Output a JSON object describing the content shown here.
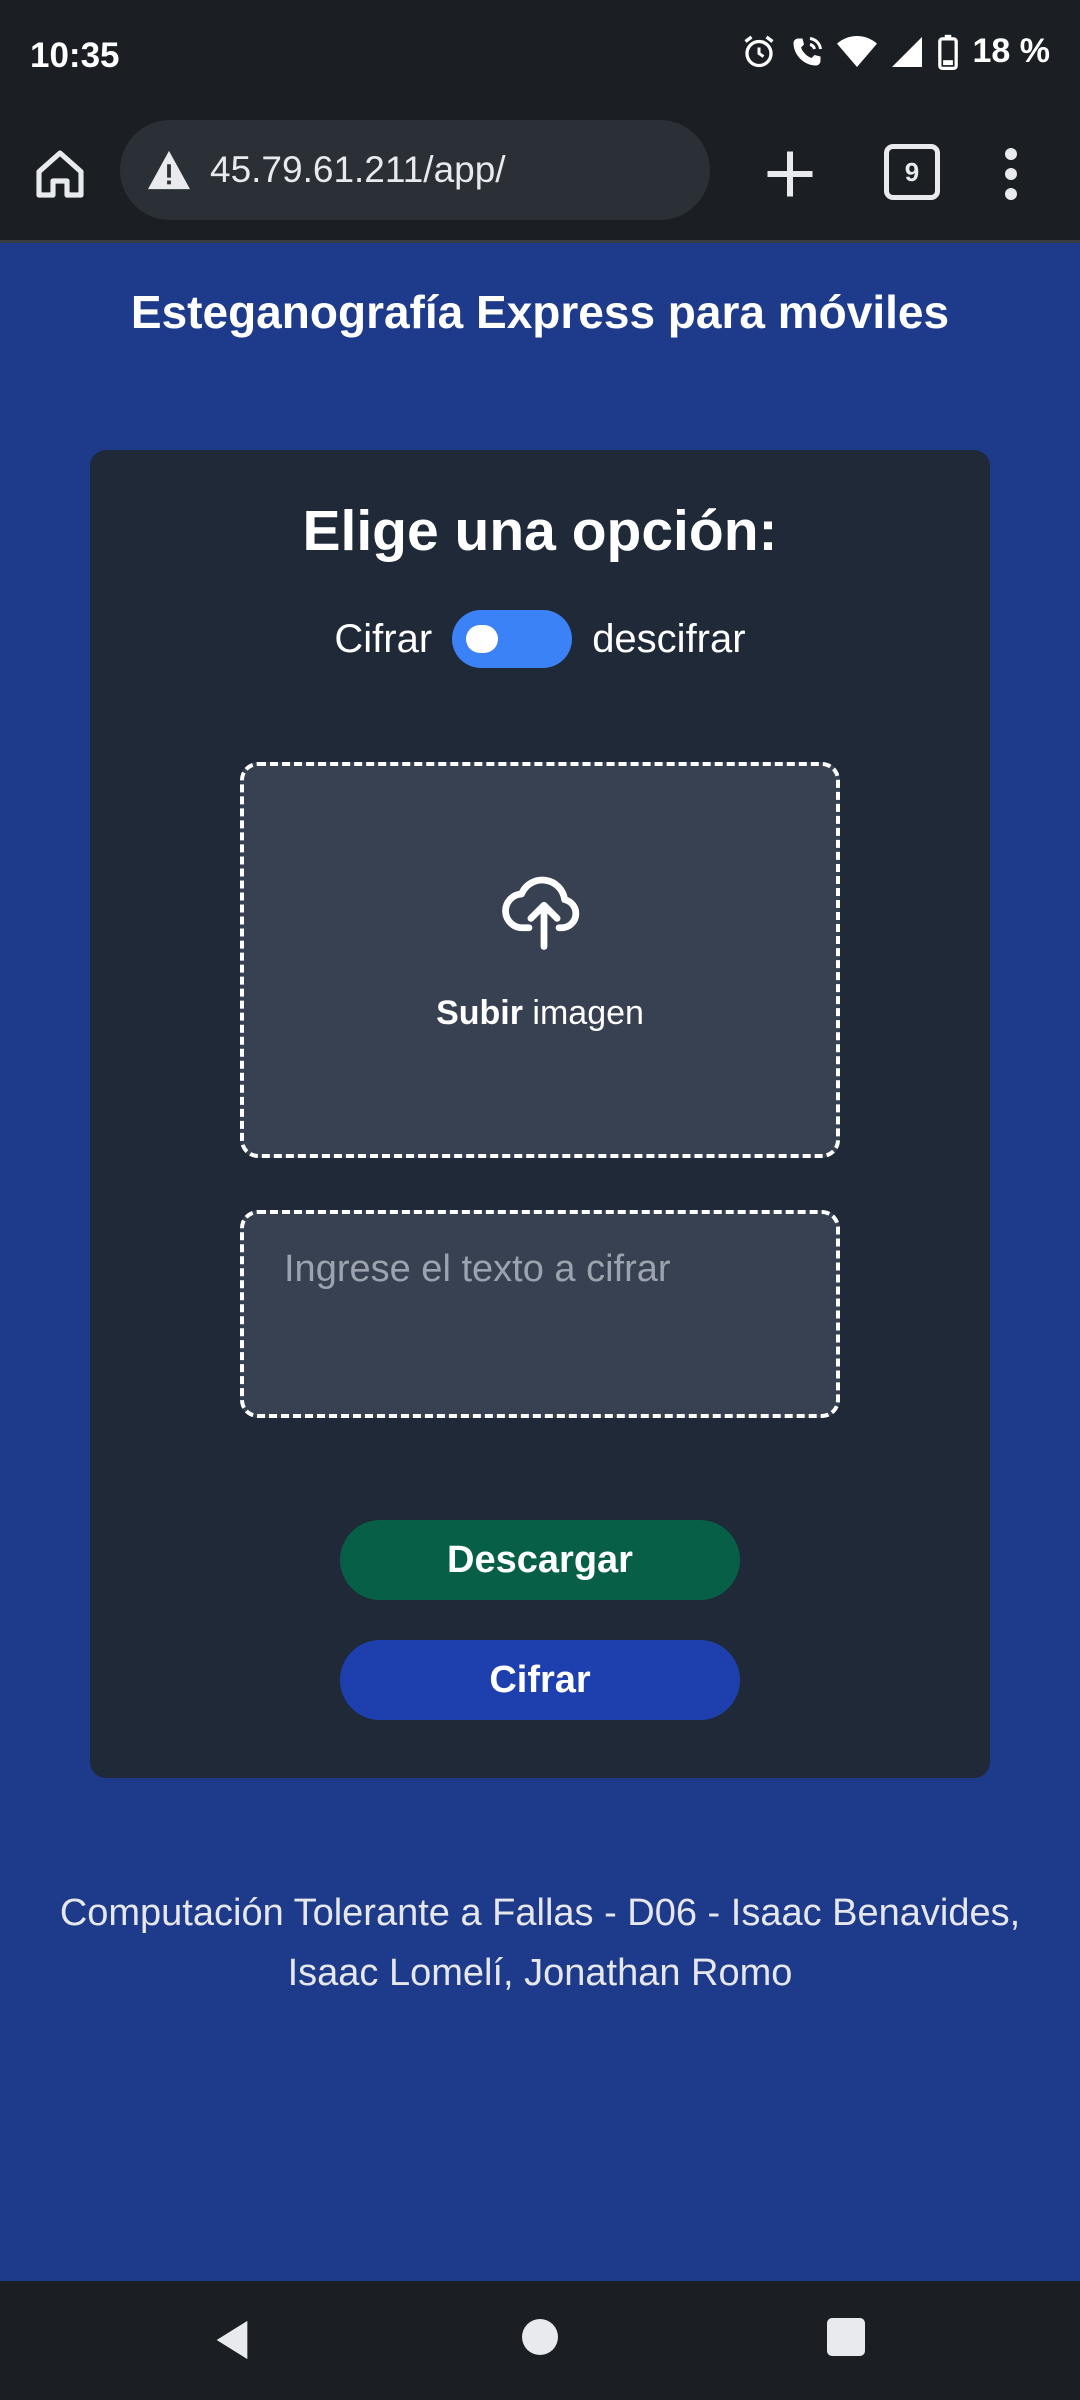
{
  "status_bar": {
    "time": "10:35",
    "battery_percent": "18 %",
    "icons": [
      "alarm-icon",
      "wifi-call-icon",
      "wifi-icon",
      "signal-icon",
      "battery-icon"
    ]
  },
  "browser": {
    "url": "45.79.61.211/app/",
    "tab_count": "9",
    "icons": [
      "home-icon",
      "not-secure-warning-icon",
      "new-tab-icon",
      "tabs-icon",
      "more-menu-icon"
    ]
  },
  "page": {
    "title": "Esteganografía Express para móviles",
    "heading": "Elige una opción:",
    "toggle": {
      "left_label": "Cifrar",
      "right_label": "descifrar",
      "state": "off"
    },
    "upload": {
      "bold_label": "Subir",
      "label": " imagen",
      "icon": "cloud-upload-icon"
    },
    "text_input": {
      "placeholder": "Ingrese el texto a cifrar",
      "value": ""
    },
    "buttons": {
      "download": "Descargar",
      "encrypt": "Cifrar"
    },
    "footer": {
      "line1": "Computación Tolerante a Fallas - D06 - Isaac Benavides,",
      "line2": "Isaac Lomelí, Jonathan Romo"
    }
  },
  "colors": {
    "page_background": "#1e3a8a",
    "card_background": "#1f2937",
    "toggle_color": "#3b82f6",
    "download_button": "#065f46",
    "encrypt_button": "#1e40af"
  },
  "nav_bar": {
    "icons": [
      "back-icon",
      "home-circle-icon",
      "recents-icon"
    ]
  }
}
